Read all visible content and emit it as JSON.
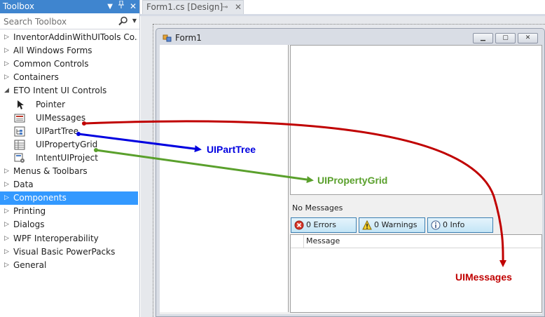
{
  "toolbox": {
    "title": "Toolbox",
    "search_placeholder": "Search Toolbox",
    "items": [
      {
        "kind": "group",
        "label": "InventorAddinWithUITools Co...",
        "expanded": false
      },
      {
        "kind": "group",
        "label": "All Windows Forms",
        "expanded": false
      },
      {
        "kind": "group",
        "label": "Common Controls",
        "expanded": false
      },
      {
        "kind": "group",
        "label": "Containers",
        "expanded": false
      },
      {
        "kind": "group",
        "label": "ETO Intent UI Controls",
        "expanded": true
      },
      {
        "kind": "item",
        "label": "Pointer",
        "icon": "pointer-icon"
      },
      {
        "kind": "item",
        "label": "UIMessages",
        "icon": "uimessages-icon"
      },
      {
        "kind": "item",
        "label": "UIPartTree",
        "icon": "uiparttree-icon"
      },
      {
        "kind": "item",
        "label": "UIPropertyGrid",
        "icon": "uipropertygrid-icon"
      },
      {
        "kind": "item",
        "label": "IntentUIProject",
        "icon": "intentuiproject-icon"
      },
      {
        "kind": "group",
        "label": "Menus & Toolbars",
        "expanded": false
      },
      {
        "kind": "group",
        "label": "Data",
        "expanded": false
      },
      {
        "kind": "group",
        "label": "Components",
        "expanded": false,
        "selected": true
      },
      {
        "kind": "group",
        "label": "Printing",
        "expanded": false
      },
      {
        "kind": "group",
        "label": "Dialogs",
        "expanded": false
      },
      {
        "kind": "group",
        "label": "WPF Interoperability",
        "expanded": false
      },
      {
        "kind": "group",
        "label": "Visual Basic PowerPacks",
        "expanded": false
      },
      {
        "kind": "group",
        "label": "General",
        "expanded": false
      }
    ]
  },
  "document_tab": {
    "label": "Form1.cs [Design]"
  },
  "form": {
    "title": "Form1",
    "message_status": "No Messages",
    "buttons": {
      "errors": "0 Errors",
      "warnings": "0 Warnings",
      "info": "0 Info"
    },
    "grid_column": "Message"
  },
  "annotations": {
    "uiparttree": "UIPartTree",
    "uipropertygrid": "UIPropertyGrid",
    "uimessages": "UIMessages"
  },
  "colors": {
    "title_bar": "#3f85cf",
    "selected_row": "#3399ff",
    "uiparttree_arrow": "#0000e0",
    "uipropertygrid_arrow": "#5aa02c",
    "uimessages_arrow": "#c00000"
  }
}
